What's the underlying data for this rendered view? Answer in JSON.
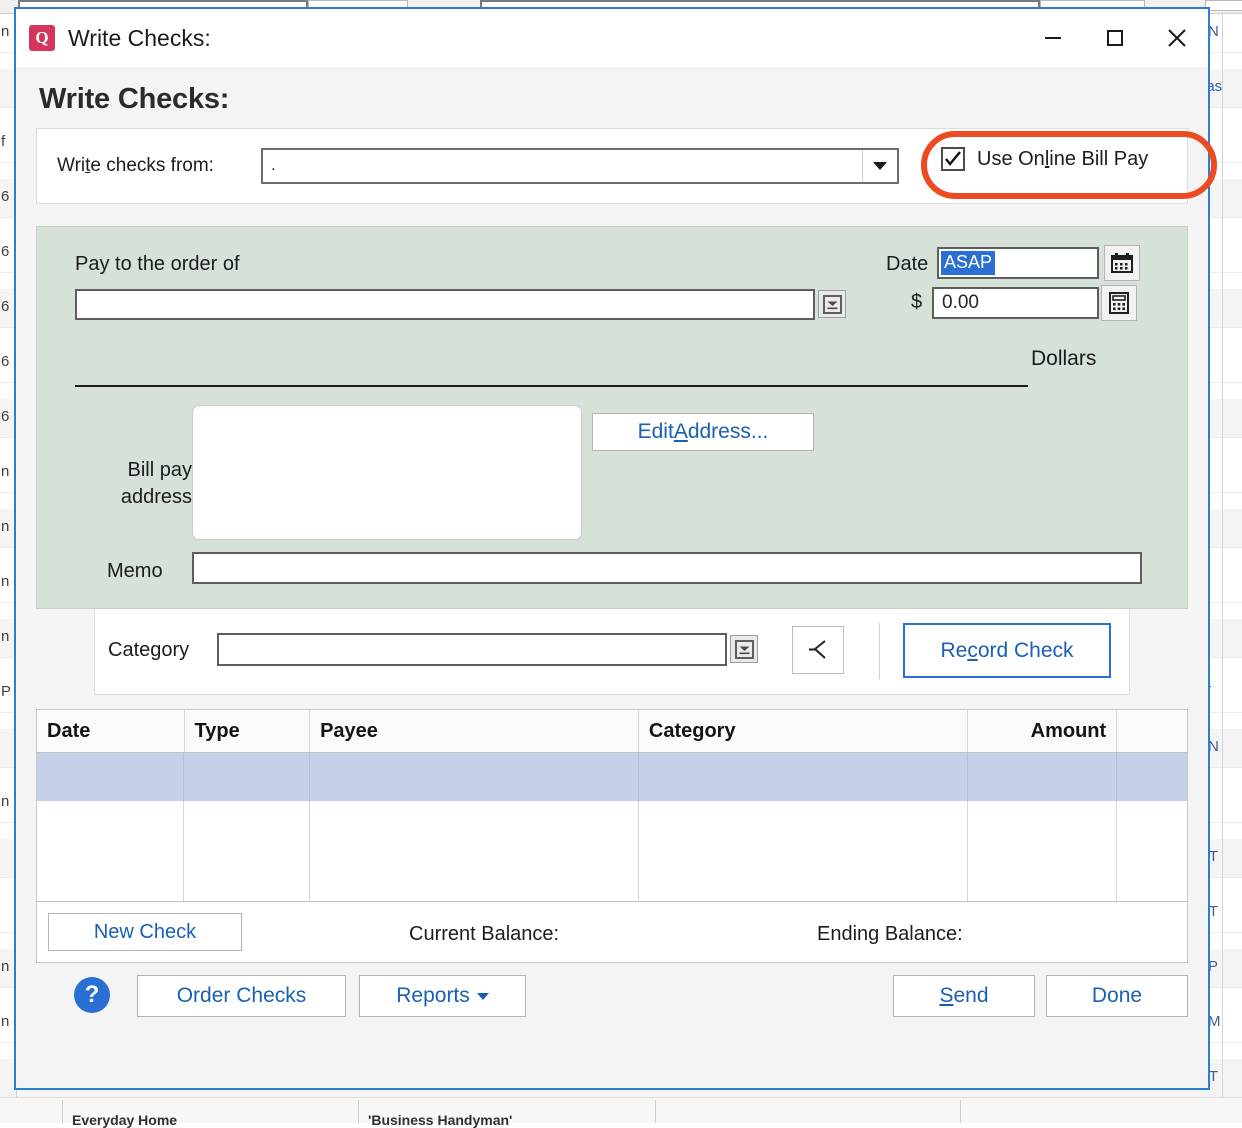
{
  "window": {
    "title": "Write Checks:",
    "logo_letter": "Q",
    "controls": {
      "minimize": "minimize-icon",
      "maximize": "maximize-icon",
      "close": "close-icon"
    }
  },
  "heading": "Write Checks:",
  "from_panel": {
    "label": "Write checks from:",
    "account_value": ".",
    "account_placeholder": "",
    "dropdown_icon": "chevron-down-icon",
    "online_bill_pay": {
      "label_before": "Use On",
      "label_accel": "l",
      "label_after": "ine Bill Pay",
      "full_label": "Use Online Bill Pay",
      "checked": true,
      "annotation_color": "#ec4a20"
    }
  },
  "check": {
    "background_color": "#d6e1d8",
    "pay_to_label": "Pay to the order of",
    "pay_to_value": "",
    "pay_to_picker_icon": "dropdown-stepper-icon",
    "date_label": "Date",
    "date_value": "ASAP",
    "date_selected": true,
    "calendar_icon": "calendar-icon",
    "currency_symbol": "$",
    "amount_value": "0.00",
    "calculator_icon": "calculator-icon",
    "dollars_label": "Dollars",
    "bill_pay_address_label": "Bill pay\naddress",
    "bill_pay_address_line1": "Bill pay",
    "bill_pay_address_line2": "address",
    "bill_pay_address_value": "",
    "edit_address_label": "Edit Address...",
    "edit_address_accel": "A",
    "memo_label": "Memo",
    "memo_value": ""
  },
  "category_row": {
    "label": "Category",
    "value": "",
    "picker_icon": "dropdown-stepper-icon",
    "split_icon": "split-transaction-icon",
    "record_button": "Record Check",
    "record_button_accel": "c",
    "record_accent_color": "#2a6fd4"
  },
  "table": {
    "columns": [
      "Date",
      "Type",
      "Payee",
      "Category",
      "Amount",
      ""
    ],
    "rows": [
      {
        "date": "",
        "type": "",
        "payee": "",
        "category": "",
        "amount": "",
        "extra": "",
        "selected": true
      }
    ],
    "selected_row_color": "#c5cfe8",
    "footer": {
      "new_check_button": "New Check",
      "current_balance_label": "Current Balance:",
      "current_balance_value": "",
      "ending_balance_label": "Ending Balance:",
      "ending_balance_value": ""
    }
  },
  "footer_bar": {
    "help_icon": "help-icon",
    "help_glyph": "?",
    "order_checks": "Order Checks",
    "reports": "Reports",
    "reports_caret": "chevron-down-icon",
    "send": "Send",
    "send_accel": "S",
    "done": "Done"
  },
  "background": {
    "left_fragments": [
      "n",
      "",
      "f",
      "6",
      "6",
      "6",
      "6",
      "6",
      "n",
      "n",
      "n",
      "n",
      "P",
      "",
      "n",
      "",
      "",
      "n",
      "n"
    ],
    "right_fragments": [
      "EN",
      "eas",
      "",
      "",
      "",
      "",
      "",
      "",
      "",
      "",
      "",
      "1",
      "IT",
      "EN",
      "1'",
      "NT",
      "NT",
      "EP",
      "PM",
      "NT"
    ],
    "bottom_fragments": [
      "Everyday Home",
      "'Business Handyman'",
      "",
      ""
    ]
  }
}
